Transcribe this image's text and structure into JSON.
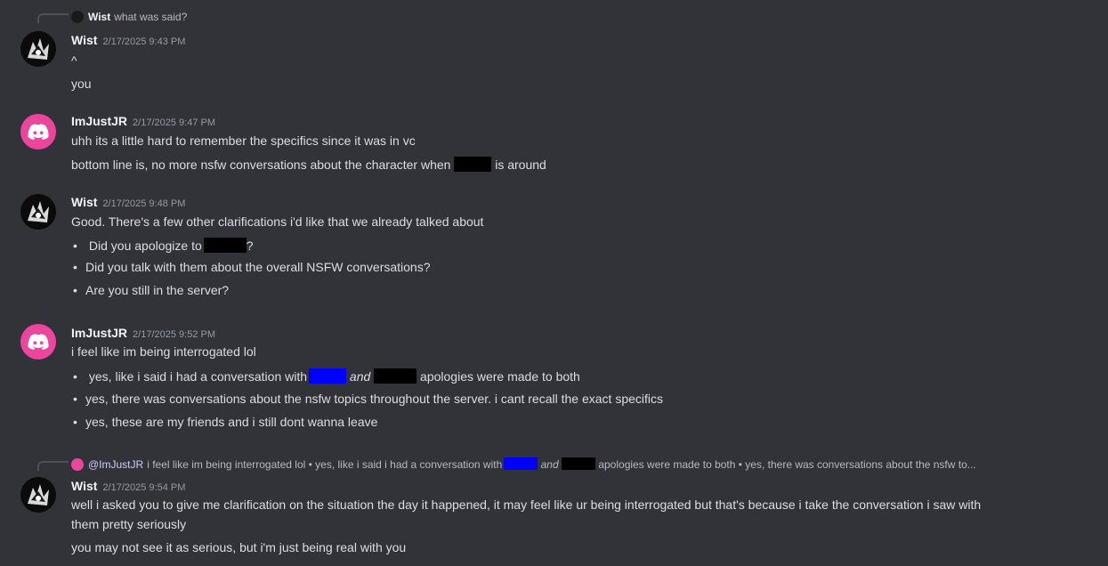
{
  "messages": [
    {
      "reply": {
        "author": "Wist",
        "text": "what was said?"
      },
      "author": "Wist",
      "timestamp": "2/17/2025 9:43 PM",
      "lines": [
        "^",
        "you"
      ]
    },
    {
      "author": "ImJustJR",
      "timestamp": "2/17/2025 9:47 PM",
      "lines": [
        "uhh its a little hard to remember the specifics since it was in vc"
      ],
      "line2_before": "bottom line is, no more nsfw conversations about the character when",
      "line2_after": "is around"
    },
    {
      "author": "Wist",
      "timestamp": "2/17/2025 9:48 PM",
      "lines": [
        "Good. There's a few other clarifications i'd like that we already talked about"
      ],
      "bullets": [
        {
          "before": "Did you apologize to",
          "after": "?"
        },
        {
          "text": "Did you talk with them about the overall NSFW conversations?"
        },
        {
          "text": "Are you still in the server?"
        }
      ]
    },
    {
      "author": "ImJustJR",
      "timestamp": "2/17/2025 9:52 PM",
      "lines": [
        "i feel like im being interrogated lol"
      ],
      "bullets": [
        {
          "before": "yes, like i said i had a conversation with",
          "middle": "and",
          "after": "apologies were made to both"
        },
        {
          "text": "yes, there was conversations about the nsfw topics throughout the server. i cant recall the exact specifics"
        },
        {
          "text": "yes, these are my friends and i still dont wanna leave"
        }
      ]
    },
    {
      "reply": {
        "mention": "@ImJustJR",
        "before": "i feel like im being interrogated lol • yes, like i said i had a conversation with",
        "middle": "and",
        "after": "apologies were made to both  • yes, there was conversations about the nsfw to..."
      },
      "author": "Wist",
      "timestamp": "2/17/2025 9:54 PM",
      "lines": [
        "well i asked you to give me clarification on the situation the day it happened, it may feel like ur being interrogated but that's because i take the conversation i saw with",
        "them pretty seriously",
        "you may not see it as serious, but i'm just being real with you"
      ]
    }
  ]
}
